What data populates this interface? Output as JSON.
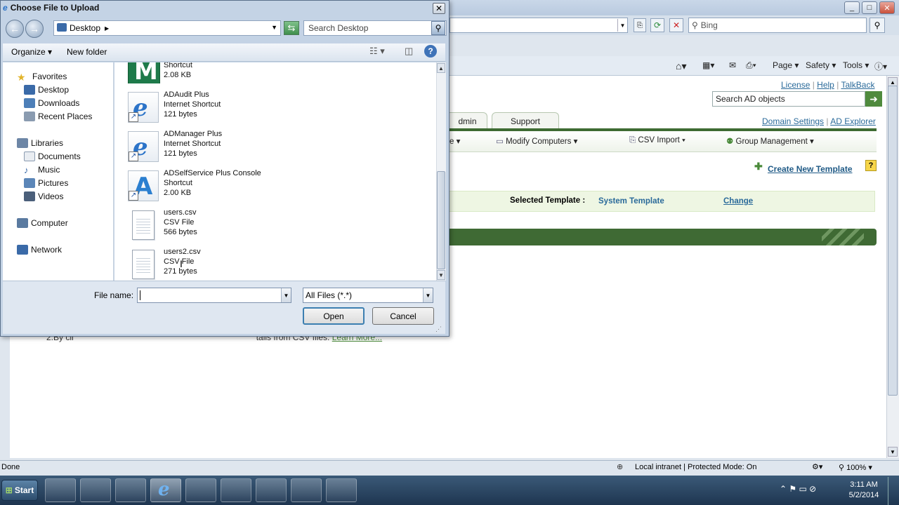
{
  "browser": {
    "address_search_placeholder": "Bing",
    "command_bar": [
      "Page",
      "Safety",
      "Tools"
    ],
    "status_left": "Done",
    "status_zone": "Local intranet | Protected Mode: On",
    "zoom": "100%"
  },
  "app": {
    "top_links": [
      "License",
      "Help",
      "TalkBack"
    ],
    "search_placeholder": "Search AD objects",
    "tabs": [
      "dmin",
      "Support"
    ],
    "settings_links": [
      "Domain Settings",
      "AD Explorer"
    ],
    "subnav": [
      "Modify Computers",
      "CSV Import",
      "Group Management"
    ],
    "create_template": "Create New Template",
    "help_badge": "?",
    "selected_template_label": "Selected Template :",
    "selected_template_value": "System Template",
    "change_link": "Change",
    "body_text_prefix": "2.By cli",
    "body_text_suffix": "tails from CSV files.",
    "learn_more": "Learn More...",
    "subnav_left_arrow": "e ▾"
  },
  "dialog": {
    "title": "Choose File to Upload",
    "location": "Desktop",
    "search_placeholder": "Search Desktop",
    "toolbar": {
      "organize": "Organize",
      "new_folder": "New folder"
    },
    "nav": {
      "favorites": "Favorites",
      "favorites_items": [
        "Desktop",
        "Downloads",
        "Recent Places"
      ],
      "libraries": "Libraries",
      "libraries_items": [
        "Documents",
        "Music",
        "Pictures",
        "Videos"
      ],
      "computer": "Computer",
      "network": "Network"
    },
    "files": [
      {
        "name": "",
        "type": "Shortcut",
        "size": "2.08 KB",
        "icon": "m-logo-icon"
      },
      {
        "name": "ADAudit Plus",
        "type": "Internet Shortcut",
        "size": "121 bytes",
        "icon": "ie-shortcut-icon"
      },
      {
        "name": "ADManager Plus",
        "type": "Internet Shortcut",
        "size": "121 bytes",
        "icon": "ie-shortcut-icon"
      },
      {
        "name": "ADSelfService Plus Console",
        "type": "Shortcut",
        "size": "2.00 KB",
        "icon": "a-logo-icon"
      },
      {
        "name": "users.csv",
        "type": "CSV File",
        "size": "566 bytes",
        "icon": "document-icon"
      },
      {
        "name": "users2.csv",
        "type": "CSV File",
        "size": "271 bytes",
        "icon": "document-icon"
      }
    ],
    "file_name_label": "File name:",
    "file_name_value": "",
    "file_type_value": "All Files (*.*)",
    "open_label": "Open",
    "cancel_label": "Cancel"
  },
  "taskbar": {
    "start_label": "Start",
    "time": "3:11 AM",
    "date": "5/2/2014"
  }
}
